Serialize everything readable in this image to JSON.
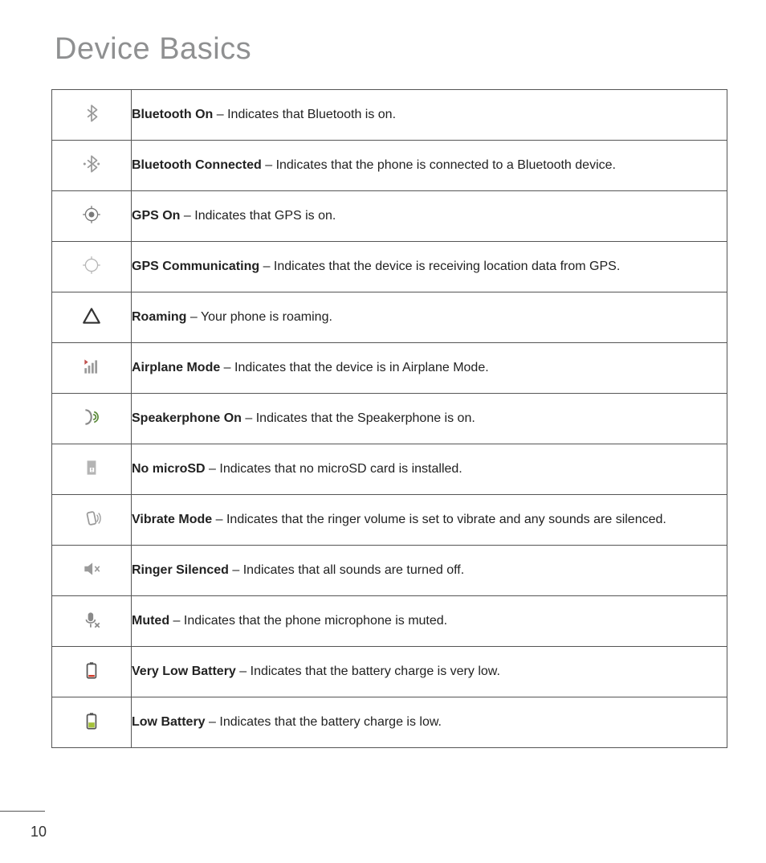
{
  "title": "Device Basics",
  "page_number": "10",
  "rows": [
    {
      "icon": "bluetooth-icon",
      "term": "Bluetooth On",
      "desc": "Indicates that Bluetooth is on."
    },
    {
      "icon": "bluetooth-connected-icon",
      "term": "Bluetooth Connected",
      "desc": "Indicates that the phone is connected to a Bluetooth device."
    },
    {
      "icon": "gps-on-icon",
      "term": "GPS On",
      "desc": "Indicates that GPS is on."
    },
    {
      "icon": "gps-communicating-icon",
      "term": "GPS Communicating",
      "desc": "Indicates that the device is receiving location data from GPS."
    },
    {
      "icon": "roaming-icon",
      "term": "Roaming",
      "desc": "Your phone is roaming."
    },
    {
      "icon": "airplane-mode-icon",
      "term": "Airplane Mode",
      "desc": "Indicates that the device is in Airplane Mode."
    },
    {
      "icon": "speakerphone-icon",
      "term": "Speakerphone On",
      "desc": "Indicates that the Speakerphone is on."
    },
    {
      "icon": "no-microsd-icon",
      "term": "No microSD",
      "desc": "Indicates that no microSD card is installed."
    },
    {
      "icon": "vibrate-mode-icon",
      "term": "Vibrate Mode",
      "desc": "Indicates that the ringer volume is set to vibrate and any sounds are silenced."
    },
    {
      "icon": "ringer-silenced-icon",
      "term": "Ringer Silenced",
      "desc": "Indicates that all sounds are turned off."
    },
    {
      "icon": "muted-icon",
      "term": "Muted",
      "desc": "Indicates that the phone microphone is muted."
    },
    {
      "icon": "very-low-battery-icon",
      "term": "Very Low Battery",
      "desc": "Indicates that the battery charge is very low."
    },
    {
      "icon": "low-battery-icon",
      "term": "Low Battery",
      "desc": "Indicates that the battery charge is low."
    }
  ]
}
